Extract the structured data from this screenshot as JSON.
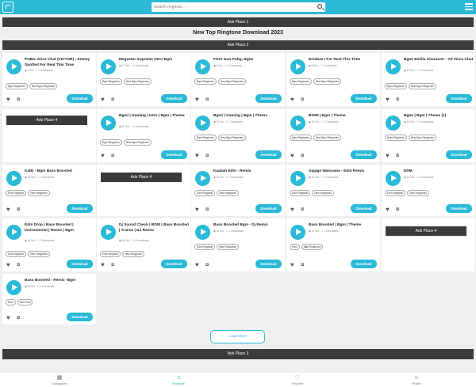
{
  "search": {
    "placeholder": "Search ringtone..."
  },
  "ads": {
    "place1": "Ads Place 1",
    "place2": "Ads Place 2",
    "place3": "Ads Place 3",
    "place4": "Ads Place 4"
  },
  "heading": "New Top Ringtone Download 2023",
  "download_label": "Download",
  "load_more": "Load More",
  "cards": [
    {
      "title": "PUBG Voice Chat (VICTOR) - Enemy Spotted For Real This Time",
      "duration": "9 Sec",
      "downloads": "1 Downloads",
      "tags": [
        "Bgm Ringtones",
        "Best Bgm Ringtones"
      ]
    },
    {
      "title": "Megastar Supreme Hero Bgm",
      "duration": "31 Sec",
      "downloads": "1 Downloads",
      "tags": [
        "Bgm Ringtones",
        "New Bgm Ringtones"
      ]
    },
    {
      "title": "Fiere Gun Pubg, Bgmi",
      "duration": "9 Sec",
      "downloads": "1 Downloads",
      "tags": [
        "Bgm Ringtones",
        "New Bgm Ringtones"
      ]
    },
    {
      "title": "Eredaze I For Real This Time",
      "duration": "9 Sec",
      "downloads": "1 Downloads",
      "tags": [
        "Bgm Ringtones",
        "New Bgm Ringtones"
      ]
    },
    {
      "title": "Bgmi Emilia Character - All Voice Chat",
      "duration": "37 Sec",
      "downloads": "1 Downloads",
      "tags": [
        "Bgm Ringtones",
        "New Bgm Ringtones"
      ]
    },
    {
      "title": "Bgmi | Gaming | Intro | Bgm | Theme",
      "duration": "30 Sec",
      "downloads": "1 Downloads",
      "tags": [
        "Bgm Ringtones",
        "New Bgm Ringtones"
      ]
    },
    {
      "title": "Bgmi | Gaming | Bgm | Theme",
      "duration": "30 Sec",
      "downloads": "1 Downloads",
      "tags": [
        "Bgm Ringtones",
        "New Bgm Ringtones"
      ]
    },
    {
      "title": "BGMI | Bgm | Theme",
      "duration": "15 Sec",
      "downloads": "1 Downloads",
      "tags": [
        "Bgm Ringtones",
        "New Bgm Ringtones"
      ]
    },
    {
      "title": "Bgmi | Bgm | Theme (1)",
      "duration": "15 Sec",
      "downloads": "1 Downloads",
      "tags": [
        "Bgm Ringtones",
        "New Bgm Ringtones"
      ]
    },
    {
      "title": "Kalki - Bgm Bass Boosted",
      "duration": "30 Sec",
      "downloads": "1 Downloads",
      "tags": [
        "Edm Ringtone",
        "New Ringtones"
      ]
    },
    {
      "title": "Kaalam Edm - Remix",
      "duration": "30 Sec",
      "downloads": "1 Downloads",
      "tags": [
        "Edm Ringtone",
        "New Ringtones"
      ]
    },
    {
      "title": "Gajage Wannama - Edm Remix",
      "duration": "30 Sec",
      "downloads": "1 Downloads",
      "tags": [
        "Edm Ringtone",
        "New Ringtones"
      ]
    },
    {
      "title": "EDM",
      "duration": "14 Sec",
      "downloads": "1 Downloads",
      "tags": [
        "Edm Ringtone",
        "New Ringtones"
      ]
    },
    {
      "title": "Edm Drop | Bass Boosted | Instrumental | Remix | Bgm",
      "duration": "30 Sec",
      "downloads": "1 Downloads",
      "tags": [
        "Edm Ringtone",
        "New Ringtones"
      ]
    },
    {
      "title": "Dj Sound Check | BGM | Bass Boosted | Trance | DJ Remix",
      "duration": "30 Sec",
      "downloads": "1 Downloads",
      "tags": [
        "Edm Ringtone",
        "New Ringtones"
      ]
    },
    {
      "title": "Bass Boosted Bgm - Dj Remix",
      "duration": "30 Sec",
      "downloads": "1 Downloads",
      "tags": [
        "Edm Ringtone",
        "New Ringtones"
      ]
    },
    {
      "title": "Bass Boosted | Bgm | Theme",
      "duration": "17 Sec",
      "downloads": "1 Downloads",
      "tags": [
        "Edm",
        "Bgm Ringtones"
      ]
    },
    {
      "title": "Bass Boosted - Remix -Bgm",
      "duration": "30 Sec",
      "downloads": "1 Downloads",
      "tags": [
        "Edm",
        "New Edm"
      ]
    }
  ],
  "nav": [
    {
      "label": "Categories",
      "icon": "grid-icon",
      "glyph": "▦"
    },
    {
      "label": "Ringtone",
      "icon": "music-note-icon",
      "glyph": "♫"
    },
    {
      "label": "Favorite",
      "icon": "heart-icon",
      "glyph": "♡"
    },
    {
      "label": "Profile",
      "icon": "user-icon",
      "glyph": "☺"
    }
  ],
  "colors": {
    "accent": "#2ab9d6",
    "ad_bar": "#3b3b3b",
    "background": "#efefef"
  }
}
